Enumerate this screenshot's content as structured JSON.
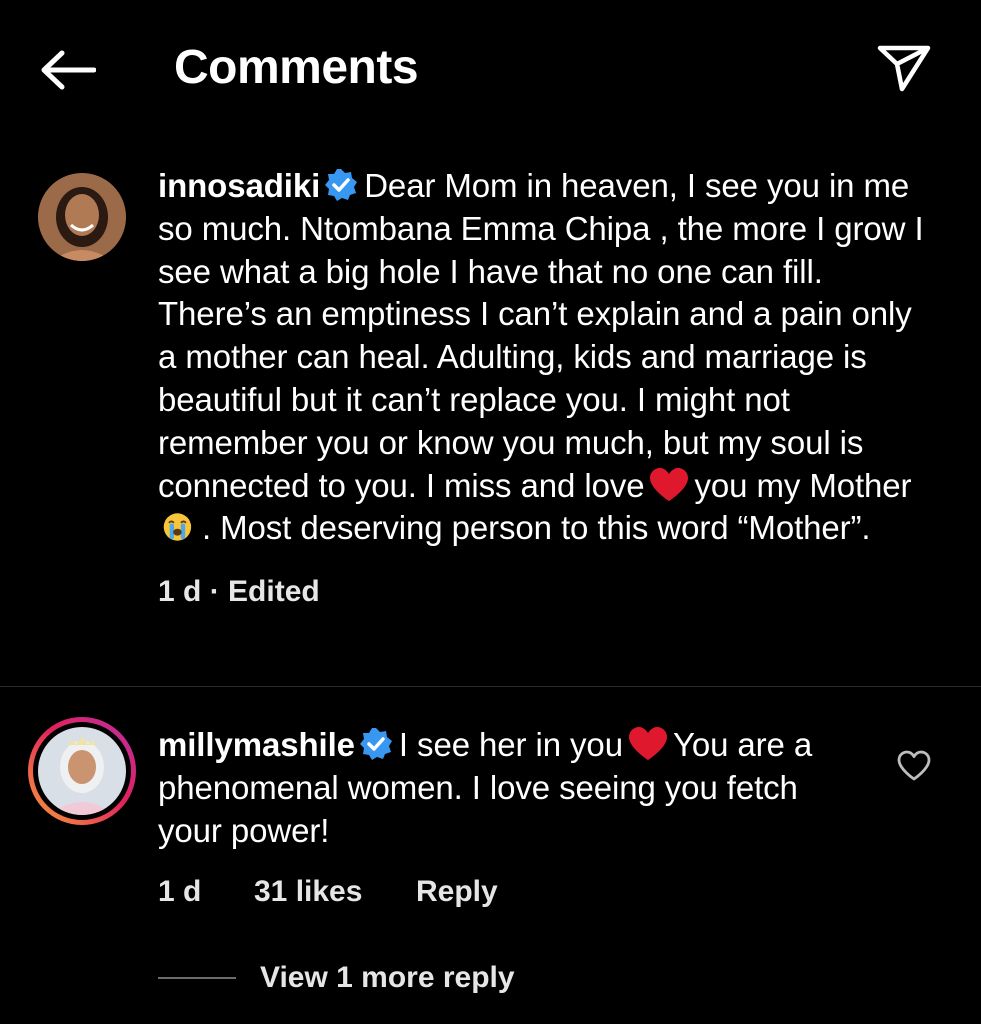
{
  "header": {
    "title": "Comments",
    "back_icon": "arrow-left-icon",
    "send_icon": "paper-plane-icon"
  },
  "caption": {
    "username": "innosadiki",
    "text_1": "Dear Mom in heaven, I see you in me so much. Ntombana Emma Chipa , the more I grow I see what a big hole I have that no one can fill. There’s an emptiness I can’t explain and a pain only a mother can heal. Adulting, kids and marriage is beautiful but it can’t replace you. I might not remember you or know you much, but my soul is connected to you. I miss and love",
    "text_2": "you my Mother",
    "text_3": ". Most deserving person to this word “Mother”.",
    "time": "1 d",
    "separator": " · ",
    "edited": "Edited"
  },
  "comment": {
    "username": "millymashile",
    "text_1": "I see her in you",
    "text_2": "You are a phenomenal women. I love seeing you fetch your power!",
    "time": "1 d",
    "likes": "31 likes",
    "reply_label": "Reply",
    "like_icon": "heart-outline-icon"
  },
  "replies": {
    "view_more_label": "View 1 more reply"
  },
  "colors": {
    "background": "#000000",
    "text": "#ffffff",
    "meta": "#e6e6e6",
    "verified": "#3897f0",
    "heart": "#e0182d"
  }
}
